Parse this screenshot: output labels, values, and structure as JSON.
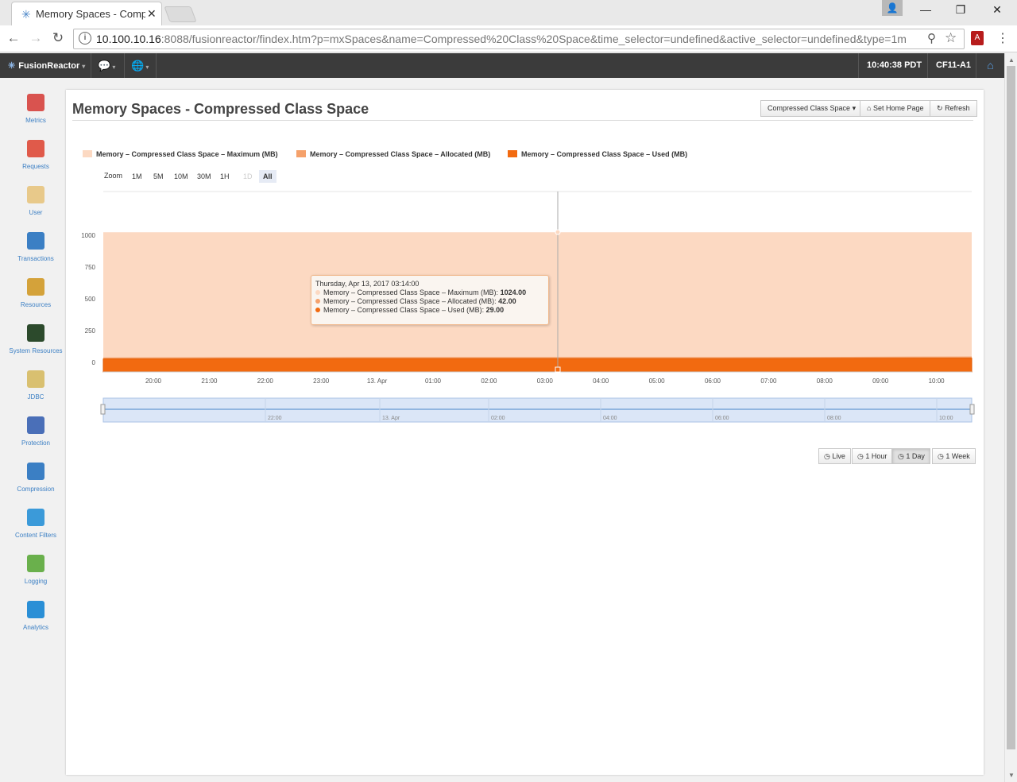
{
  "browser": {
    "tab_title": "Memory Spaces - Compr",
    "url_host": "10.100.10.16",
    "url_rest": ":8088/fusionreactor/findex.htm?p=mxSpaces&name=Compressed%20Class%20Space&time_selector=undefined&active_selector=undefined&type=1m"
  },
  "header": {
    "brand": "FusionReactor",
    "clock": "10:40:38 PDT",
    "server": "CF11-A1"
  },
  "sidebar": {
    "items": [
      {
        "label": "Metrics",
        "icon": "metrics-chart-icon",
        "color": "#d9534f"
      },
      {
        "label": "Requests",
        "icon": "requests-icon",
        "color": "#e05a4a"
      },
      {
        "label": "User",
        "icon": "user-icon",
        "color": "#e8c98a"
      },
      {
        "label": "Transactions",
        "icon": "transactions-arrows-icon",
        "color": "#3b7fc4"
      },
      {
        "label": "Resources",
        "icon": "gauge-icon",
        "color": "#d4a23a"
      },
      {
        "label": "System Resources",
        "icon": "monitor-icon",
        "color": "#2c4a2c"
      },
      {
        "label": "JDBC",
        "icon": "database-icon",
        "color": "#d9c070"
      },
      {
        "label": "Protection",
        "icon": "shield-icon",
        "color": "#4a6fb8"
      },
      {
        "label": "Compression",
        "icon": "compression-icon",
        "color": "#3b7fc4"
      },
      {
        "label": "Content Filters",
        "icon": "funnel-icon",
        "color": "#3b9ad9"
      },
      {
        "label": "Logging",
        "icon": "logging-icon",
        "color": "#6ab04c"
      },
      {
        "label": "Analytics",
        "icon": "cube-icon",
        "color": "#2a8fd6"
      }
    ]
  },
  "page": {
    "title": "Memory Spaces - Compressed Class Space",
    "selector_label": "Compressed Class Space",
    "set_home_label": "Set Home Page",
    "refresh_label": "Refresh"
  },
  "zoom": {
    "label": "Zoom",
    "options": [
      "1M",
      "5M",
      "10M",
      "30M",
      "1H",
      "1D",
      "All"
    ]
  },
  "ranges": [
    "Live",
    "1 Hour",
    "1 Day",
    "1 Week"
  ],
  "tooltip": {
    "date": "Thursday, Apr 13, 2017 03:14:00",
    "rows": [
      {
        "label": "Memory – Compressed Class Space – Maximum (MB):",
        "value": "1024.00"
      },
      {
        "label": "Memory – Compressed Class Space – Allocated (MB):",
        "value": "42.00"
      },
      {
        "label": "Memory – Compressed Class Space – Used (MB):",
        "value": "29.00"
      }
    ]
  },
  "chart_data": {
    "type": "area",
    "x_ticks": [
      "20:00",
      "21:00",
      "22:00",
      "23:00",
      "13. Apr",
      "01:00",
      "02:00",
      "03:00",
      "04:00",
      "05:00",
      "06:00",
      "07:00",
      "08:00",
      "09:00",
      "10:00"
    ],
    "y_ticks": [
      0,
      250,
      500,
      750,
      1000
    ],
    "ylim": [
      0,
      1000
    ],
    "navigator_ticks": [
      "22:00",
      "13. Apr",
      "02:00",
      "04:00",
      "06:00",
      "08:00",
      "10:00"
    ],
    "series": [
      {
        "name": "Memory – Compressed Class Space – Maximum (MB)",
        "color": "#fcd9c2",
        "values": [
          1024,
          1024,
          1024,
          1024,
          1024,
          1024,
          1024,
          1024,
          1024,
          1024,
          1024,
          1024,
          1024,
          1024,
          1024
        ]
      },
      {
        "name": "Memory – Compressed Class Space – Allocated (MB)",
        "color": "#f5a16b",
        "values": [
          38,
          40,
          41,
          41,
          42,
          42,
          42,
          42,
          42,
          42,
          42,
          43,
          44,
          45,
          46
        ]
      },
      {
        "name": "Memory – Compressed Class Space – Used (MB)",
        "color": "#f26a10",
        "values": [
          26,
          27,
          28,
          28,
          29,
          29,
          29,
          29,
          29,
          29,
          29,
          30,
          31,
          32,
          33
        ]
      }
    ]
  }
}
